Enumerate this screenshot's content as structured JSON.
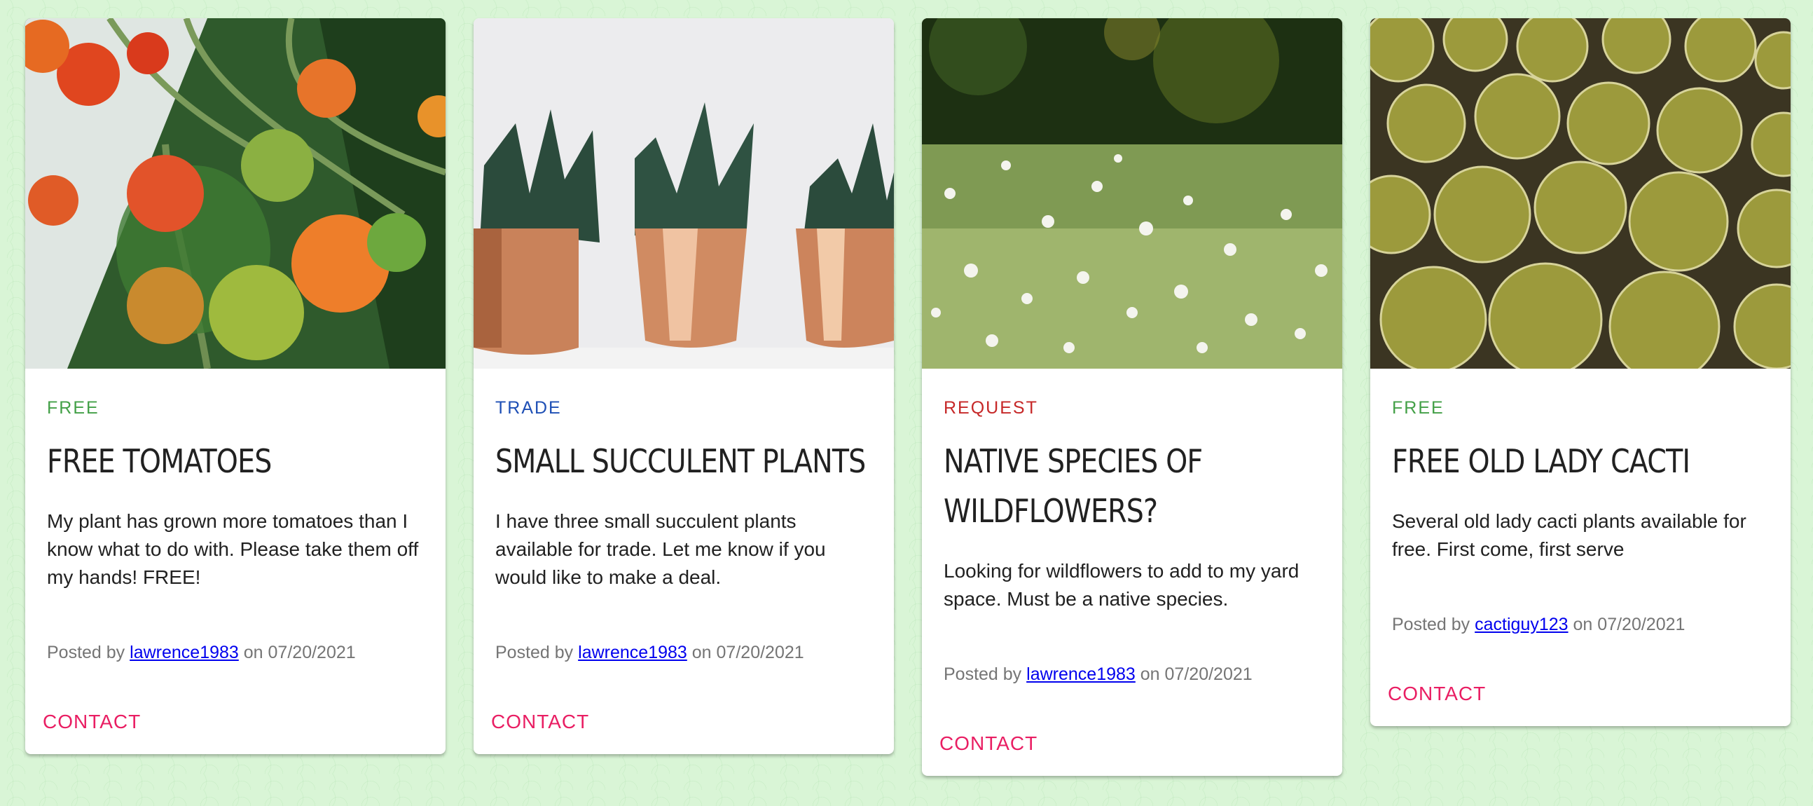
{
  "cards": [
    {
      "tag": "FREE",
      "tag_color": "#43a047",
      "title_lines": [
        "FREE TOMATOES"
      ],
      "description": "My plant has grown more tomatoes than I know what to do with. Please take them off my hands! FREE!",
      "posted_prefix": "Posted by",
      "author": "lawrence1983",
      "posted_mid": "on",
      "date": "07/20/2021",
      "contact_label": "CONTACT",
      "image": "tomatoes-photo"
    },
    {
      "tag": "TRADE",
      "tag_color": "#1e4fb5",
      "title_lines": [
        "SMALL SUCCULENT PLANTS"
      ],
      "description": "I have three small succulent plants available for trade. Let me know if you would like to make a deal.",
      "posted_prefix": "Posted by",
      "author": "lawrence1983",
      "posted_mid": "on",
      "date": "07/20/2021",
      "contact_label": "CONTACT",
      "image": "succulents-photo"
    },
    {
      "tag": "REQUEST",
      "tag_color": "#c62828",
      "title_lines": [
        "NATIVE SPECIES OF",
        "WILDFLOWERS?"
      ],
      "description": "Looking for wildflowers to add to my yard space. Must be a native species.",
      "posted_prefix": "Posted by",
      "author": "lawrence1983",
      "posted_mid": "on",
      "date": "07/20/2021",
      "contact_label": "CONTACT",
      "image": "wildflowers-photo"
    },
    {
      "tag": "FREE",
      "tag_color": "#43a047",
      "title_lines": [
        "FREE OLD LADY CACTI"
      ],
      "description": "Several old lady cacti plants available for free. First come, first serve",
      "posted_prefix": "Posted by",
      "author": "cactiguy123",
      "posted_mid": "on",
      "date": "07/20/2021",
      "contact_label": "CONTACT",
      "image": "cacti-photo"
    }
  ]
}
